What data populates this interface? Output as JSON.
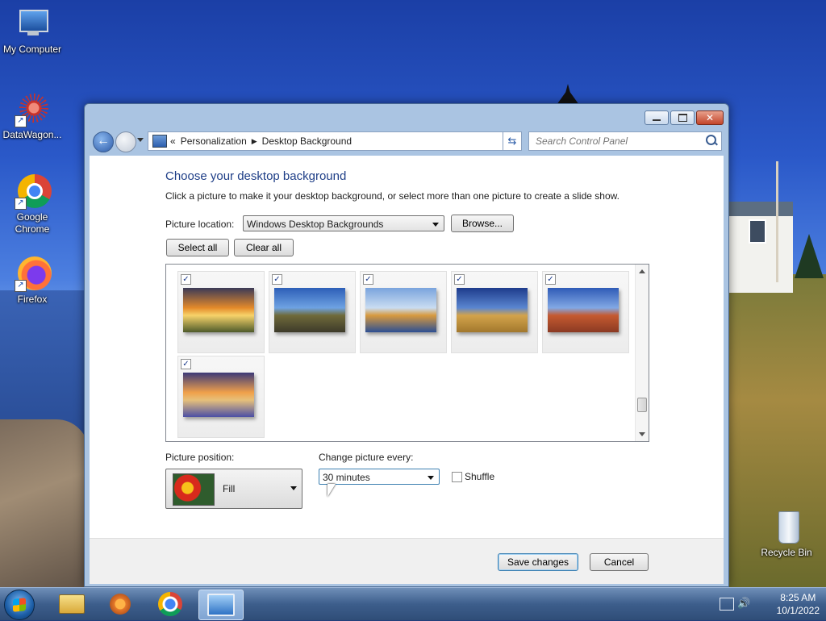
{
  "desktop": {
    "icons": [
      {
        "label": "My Computer"
      },
      {
        "label": "DataWagon..."
      },
      {
        "label": "Google\nChrome"
      },
      {
        "label": "Firefox"
      },
      {
        "label": "Recycle Bin"
      }
    ]
  },
  "window": {
    "address": {
      "crumbs": [
        "Personalization",
        "Desktop Background"
      ],
      "prefix": "«",
      "separator": "▶"
    },
    "search": {
      "placeholder": "Search Control Panel"
    },
    "heading": "Choose your desktop background",
    "description": "Click a picture to make it your desktop background, or select more than one picture to create a slide show.",
    "picture_location": {
      "label": "Picture location:",
      "value": "Windows Desktop Backgrounds",
      "browse": "Browse..."
    },
    "select_all": "Select all",
    "clear_all": "Clear all",
    "pictures": [
      {
        "name": "sunset-field",
        "checked": true,
        "colors": [
          "#3b3a57",
          "#e48a2a",
          "#f7d36a",
          "#4d5a2a"
        ]
      },
      {
        "name": "lighthouse",
        "checked": true,
        "colors": [
          "#2d5fb8",
          "#6ea2e2",
          "#6f6a3a",
          "#3d3a2a"
        ]
      },
      {
        "name": "sea-rock",
        "checked": true,
        "colors": [
          "#7aa4dd",
          "#c9dcf1",
          "#d89a3e",
          "#2c4f94"
        ]
      },
      {
        "name": "hay-bale",
        "checked": true,
        "colors": [
          "#1e3c8c",
          "#5a86d0",
          "#d3a34b",
          "#a2782d"
        ]
      },
      {
        "name": "arch-rock",
        "checked": true,
        "colors": [
          "#2f5bb7",
          "#82a8e4",
          "#c55a30",
          "#8b3a23"
        ]
      },
      {
        "name": "lupine-lake",
        "checked": true,
        "colors": [
          "#3c3a78",
          "#f0a04a",
          "#e6c07a",
          "#4b4fa6"
        ]
      }
    ],
    "picture_position": {
      "label": "Picture position:",
      "value": "Fill"
    },
    "change_picture": {
      "label": "Change picture every:",
      "value": "30 minutes"
    },
    "shuffle": {
      "label": "Shuffle",
      "checked": false
    },
    "save": "Save changes",
    "cancel": "Cancel"
  },
  "taskbar": {
    "time": "8:25 AM",
    "date": "10/1/2022"
  }
}
